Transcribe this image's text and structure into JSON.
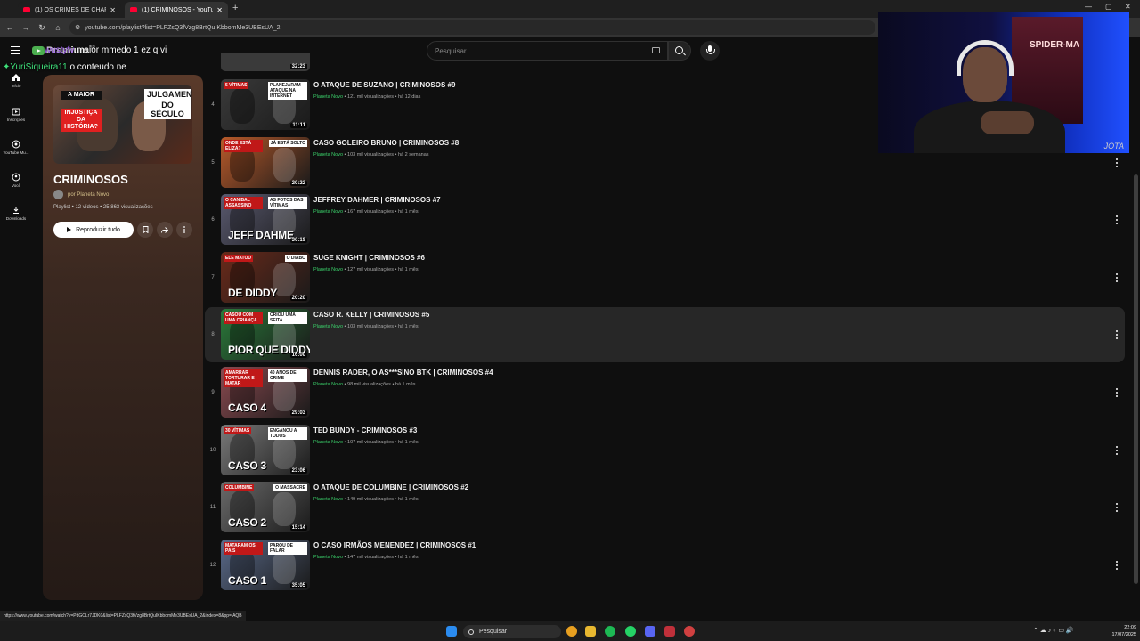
{
  "browser": {
    "tabs": [
      {
        "label": "(1) OS CRIMES DE CHARLES M..."
      },
      {
        "label": "(1) CRIMINOSOS - YouTube"
      }
    ],
    "url": "youtube.com/playlist?list=PLFZsQ3fVzg8BrtQuIKbbomMe3UBEsUA_2",
    "status_url": "https://www.youtube.com/watch?v=PdGCLr7JDK0&list=PLFZsQ3fVzg8BrtQuIKbbomMe3UBEsUA_2&index=8&pp=iAQB"
  },
  "header": {
    "logo": "Premium",
    "logo_region": "BR",
    "search_placeholder": "Pesquisar"
  },
  "rail": [
    {
      "label": "Início",
      "icon": "home-icon"
    },
    {
      "label": "Inscrições",
      "icon": "subscriptions-icon"
    },
    {
      "label": "YouTube Mu...",
      "icon": "music-icon"
    },
    {
      "label": "Você",
      "icon": "you-icon"
    },
    {
      "label": "Downloads",
      "icon": "download-icon"
    }
  ],
  "playlist": {
    "thumb_tags": {
      "t1": "A MAIOR",
      "t2": "JULGAMENTO",
      "t3": "INJUSTIÇA DA HISTÓRIA?",
      "t4": "DO SÉCULO"
    },
    "title": "CRIMINOSOS",
    "owner_prefix": "por",
    "owner": "Planeta Novo",
    "meta": "Playlist • 12 vídeos • 25.863 visualizações",
    "play_all": "Reproduzir tudo"
  },
  "chat": [
    {
      "user": "wustyfv",
      "text": " maior mmedo 1 ez q vi"
    },
    {
      "user": "✦YuriSiqueira11",
      "text": " o conteudo ne"
    }
  ],
  "first_thumb_duration": "32:23",
  "videos": [
    {
      "index": "4",
      "title": "O ATAQUE DE SUZANO | CRIMINOSOS #9",
      "channel": "Planeta Novo",
      "meta": " • 121 mil visualizações • há 12 dias",
      "duration": "11:11",
      "caption": "",
      "tl": "5 VÍTIMAS",
      "tr": "PLANEJARAM ATAQUE NA INTERNET",
      "bg": "#3a3a3a"
    },
    {
      "index": "5",
      "title": "CASO GOLEIRO BRUNO | CRIMINOSOS #8",
      "channel": "Planeta Novo",
      "meta": " • 103 mil visualizações • há 2 semanas",
      "duration": "20:22",
      "caption": "",
      "tl": "ONDE ESTÁ ELIZA?",
      "tr": "JÁ ESTÁ SOLTO",
      "bg": "#b85a2a"
    },
    {
      "index": "6",
      "title": "JEFFREY DAHMER | CRIMINOSOS #7",
      "channel": "Planeta Novo",
      "meta": " • 167 mil visualizações • há 1 mês",
      "duration": "36:19",
      "caption": "JEFF DAHME",
      "tl": "O CANIBAL ASSASSINO",
      "tr": "AS FOTOS DAS VÍTIMAS",
      "bg": "#5a5a70"
    },
    {
      "index": "7",
      "title": "SUGE KNIGHT | CRIMINOSOS #6",
      "channel": "Planeta Novo",
      "meta": " • 127 mil visualizações • há 1 mês",
      "duration": "20:20",
      "caption": "DE DIDDY",
      "tl": "ELE MATOU",
      "tr": "O DIABO",
      "bg": "#6a2a1a"
    },
    {
      "index": "8",
      "title": "CASO R. KELLY | CRIMINOSOS #5",
      "channel": "Planeta Novo",
      "meta": " • 103 mil visualizações • há 1 mês",
      "duration": "16:00",
      "caption": "PIOR QUE DIDDY",
      "tl": "CASOU COM UMA CRIANÇA",
      "tr": "CRIOU UMA SEITA",
      "bg": "#2a7a3a",
      "highlight": true
    },
    {
      "index": "9",
      "title": "DENNIS RADER, O AS***SINO BTK | CRIMINOSOS #4",
      "channel": "Planeta Novo",
      "meta": " • 98 mil visualizações • há 1 mês",
      "duration": "29:03",
      "caption": "CASO 4",
      "tl": "AMARRAR TORTURAR E MATAR",
      "tr": "40 ANOS DE CRIME",
      "bg": "#8a4a50"
    },
    {
      "index": "10",
      "title": "TED BUNDY - CRIMINOSOS #3",
      "channel": "Planeta Novo",
      "meta": " • 107 mil visualizações • há 1 mês",
      "duration": "23:06",
      "caption": "CASO 3",
      "tl": "30 VÍTIMAS",
      "tr": "ENGANOU A TODOS",
      "bg": "#7a7a7a"
    },
    {
      "index": "11",
      "title": "O ATAQUE DE COLUMBINE | CRIMINOSOS #2",
      "channel": "Planeta Novo",
      "meta": " • 149 mil visualizações • há 1 mês",
      "duration": "15:14",
      "caption": "CASO 2",
      "tl": "COLUMBINE",
      "tr": "O MASSACRE",
      "bg": "#6a6a6a"
    },
    {
      "index": "12",
      "title": "O CASO IRMÃOS MENENDEZ | CRIMINOSOS #1",
      "channel": "Planeta Novo",
      "meta": " • 147 mil visualizações • há 1 mês",
      "duration": "35:05",
      "caption": "CASO 1",
      "tl": "MATARAM OS PAIS",
      "tr": "PAROU DE FALAR",
      "bg": "#5a6a8a"
    }
  ],
  "webcam": {
    "poster": "SPIDER-MA",
    "watermark": "JOTA"
  },
  "taskbar": {
    "search": "Pesquisar",
    "time": "22:09",
    "date": "17/07/2025"
  }
}
